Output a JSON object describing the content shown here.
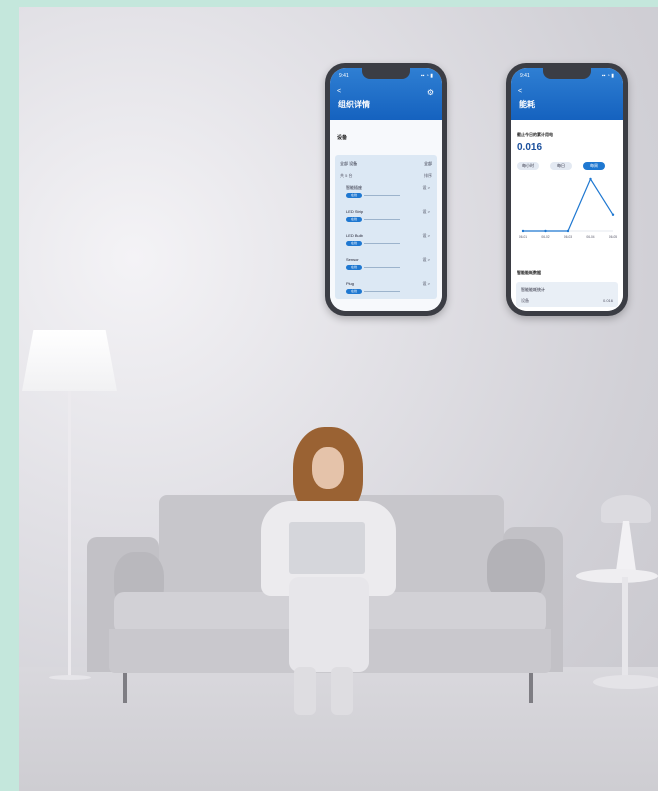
{
  "phone1": {
    "status_time": "9:41",
    "status_icons": "▪▪ ◔ ▮",
    "back_label": "<",
    "title": "组织详情",
    "settings_icon": "gear-icon",
    "section_title": "设备",
    "panel_header_left": "全部   设备",
    "panel_header_right": "全部",
    "panel_sub_left": "共 5 台",
    "panel_sub_right": "排序",
    "devices": [
      {
        "name": "智能插座",
        "chip": "在线",
        "value": "设 >"
      },
      {
        "name": "LED Strip",
        "chip": "在线",
        "value": "设 >"
      },
      {
        "name": "LED Bulb",
        "chip": "在线",
        "value": "设 >"
      },
      {
        "name": "Sensor",
        "chip": "在线",
        "value": "设 >"
      },
      {
        "name": "Plug",
        "chip": "在线",
        "value": "设 >"
      }
    ]
  },
  "phone2": {
    "status_time": "9:41",
    "status_icons": "▪▪ ◔ ▮",
    "back_label": "<",
    "title": "能耗",
    "label": "截止今日的累计用电",
    "value": "0.016",
    "segments": [
      {
        "label": "每小时",
        "active": false
      },
      {
        "label": "每日",
        "active": false
      },
      {
        "label": "每周",
        "active": true
      }
    ],
    "x_ticks": [
      "06-01",
      "06-02",
      "06-03",
      "06-04",
      "06-05"
    ],
    "footer_title": "智能能耗数据",
    "card_title": "智能能耗统计",
    "card_row_left": "设备",
    "card_row_right": "0.016"
  },
  "chart_data": {
    "type": "line",
    "x": [
      "06-01",
      "06-02",
      "06-03",
      "06-04",
      "06-05"
    ],
    "series": [
      {
        "values": [
          0,
          0,
          0,
          0.016,
          0.005
        ]
      }
    ],
    "color": "#1f78d1"
  }
}
